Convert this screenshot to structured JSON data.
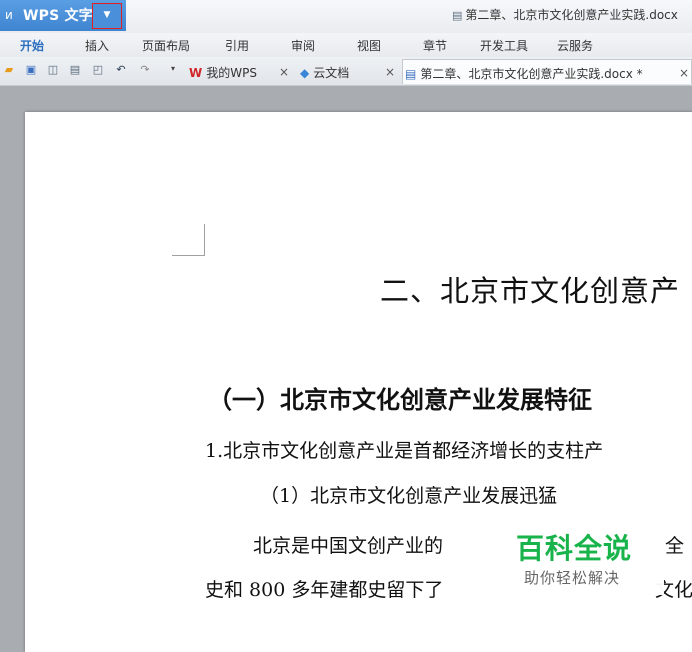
{
  "app": {
    "logo_glyph": "ᴎ",
    "name": "WPS 文字",
    "menu_arrow": "▼",
    "document_title": "第二章、北京市文化创意产业实践.docx"
  },
  "ribbon": {
    "tabs": [
      "开始",
      "插入",
      "页面布局",
      "引用",
      "审阅",
      "视图",
      "章节",
      "开发工具",
      "云服务"
    ],
    "active_tab": "开始"
  },
  "toolbar": {
    "icons": [
      "open-icon",
      "save-icon",
      "print-preview-icon",
      "print-icon",
      "export-pdf-icon",
      "undo-icon",
      "redo-icon"
    ],
    "dropdown": "▾"
  },
  "doc_tabs": [
    {
      "label": "我的WPS",
      "icon": "wps-logo-icon",
      "close": "×"
    },
    {
      "label": "云文档",
      "icon": "cloud-icon",
      "close": "×"
    },
    {
      "label": "第二章、北京市文化创意产业实践.docx *",
      "icon": "document-icon",
      "close": "×"
    }
  ],
  "document": {
    "heading1": "二、北京市文化创意产",
    "heading2": "（一）北京市文化创意产业发展特征",
    "para1": "1.北京市文化创意产业是首都经济增长的支柱产",
    "para2": "（1）北京市文化创意产业发展迅猛",
    "para3": "北京是中国文创产业的",
    "para3_tail": "全",
    "para4": "史和 800 多年建都史留下了",
    "para4_tail": "文化"
  },
  "watermark": {
    "title": "百科全说",
    "subtitle": "助你轻松解决",
    "color": "#18b34a"
  },
  "colors": {
    "app_button": "#4a8fda",
    "highlight_border": "#e02020",
    "active_tab": "#2e6fc0"
  }
}
